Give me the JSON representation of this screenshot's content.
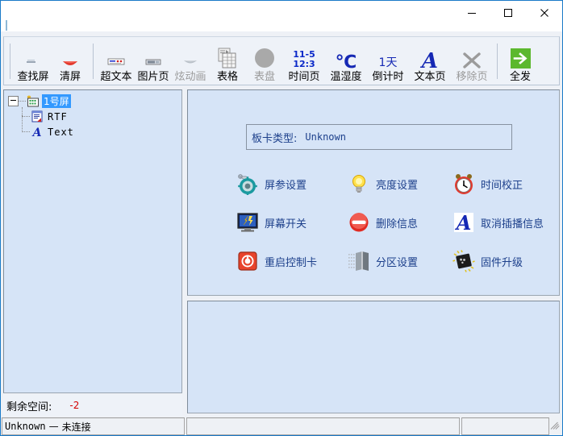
{
  "window": {
    "title": "",
    "minimize_label": "minimize",
    "maximize_label": "maximize",
    "close_label": "close"
  },
  "toolbar": {
    "items": [
      {
        "label": "查找屏",
        "icon": "find-screen-icon",
        "disabled": false
      },
      {
        "label": "清屏",
        "icon": "clear-screen-icon",
        "disabled": false
      },
      {
        "sep": true
      },
      {
        "label": "超文本",
        "icon": "hypertext-icon",
        "disabled": false
      },
      {
        "label": "图片页",
        "icon": "image-page-icon",
        "disabled": false
      },
      {
        "label": "炫动画",
        "icon": "animation-icon",
        "disabled": true
      },
      {
        "label": "表格",
        "icon": "table-icon",
        "disabled": true
      },
      {
        "label": "表盘",
        "icon": "dial-icon",
        "disabled": true
      },
      {
        "label": "时间页",
        "icon": "time-page-icon",
        "disabled": false
      },
      {
        "label": "温湿度",
        "icon": "temperature-humidity-icon",
        "disabled": false
      },
      {
        "label": "倒计时",
        "icon": "countdown-icon",
        "disabled": false
      },
      {
        "label": "文本页",
        "icon": "text-page-icon",
        "disabled": false
      },
      {
        "label": "移除页",
        "icon": "remove-page-icon",
        "disabled": true
      },
      {
        "sep": true
      },
      {
        "label": "全发",
        "icon": "send-all-icon",
        "disabled": false
      }
    ],
    "time_icon_line1": "11-5",
    "time_icon_line2": "12:3",
    "temp_icon_text": "℃",
    "countdown_icon_text": "1天",
    "text_icon_letter": "A"
  },
  "tree": {
    "root": {
      "label": "1号屏",
      "icon": "screen-icon",
      "selected": true
    },
    "children": [
      {
        "label": "RTF",
        "icon": "rtf-page-icon"
      },
      {
        "label": "Text",
        "icon": "text-page-icon"
      }
    ]
  },
  "space": {
    "label": "剩余空间:",
    "value": "-2",
    "value_color": "#d40000"
  },
  "main": {
    "card_type_label": "板卡类型:",
    "card_type_value": "Unknown",
    "buttons": [
      {
        "label": "屏参设置",
        "icon": "screen-params-icon"
      },
      {
        "label": "亮度设置",
        "icon": "brightness-icon"
      },
      {
        "label": "时间校正",
        "icon": "time-correction-icon"
      },
      {
        "label": "屏幕开关",
        "icon": "screen-power-icon"
      },
      {
        "label": "删除信息",
        "icon": "delete-info-icon"
      },
      {
        "label": "取消插播信息",
        "icon": "cancel-insert-icon"
      },
      {
        "label": "重启控制卡",
        "icon": "restart-card-icon"
      },
      {
        "label": "分区设置",
        "icon": "partition-icon"
      },
      {
        "label": "固件升级",
        "icon": "firmware-upgrade-icon"
      }
    ]
  },
  "statusbar": {
    "cell1_device": "Unknown",
    "cell1_sep": "—",
    "cell1_status": "未连接",
    "cell2": "",
    "cell3": ""
  },
  "colors": {
    "accent": "#1a7ac8",
    "panel_bg": "#d6e4f7",
    "toolbar_bg": "#eef2f8",
    "label_blue": "#1c3f8b",
    "selection": "#3399ff",
    "send_green": "#5cb82e",
    "error_red": "#d40000"
  }
}
